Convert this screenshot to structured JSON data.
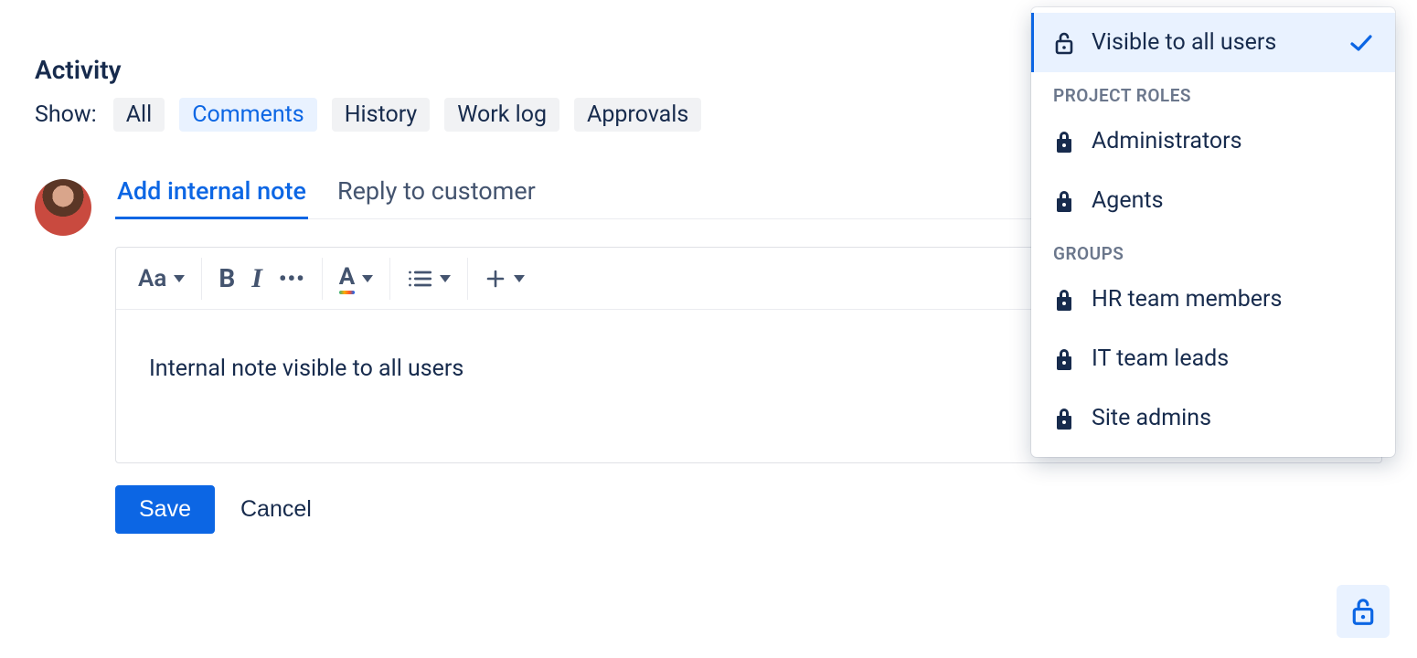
{
  "activity": {
    "heading": "Activity",
    "show_label": "Show:",
    "filters": {
      "all": "All",
      "comments": "Comments",
      "history": "History",
      "work_log": "Work log",
      "approvals": "Approvals"
    }
  },
  "compose": {
    "tabs": {
      "internal": "Add internal note",
      "reply": "Reply to customer"
    },
    "content": "Internal note visible to all users",
    "buttons": {
      "save": "Save",
      "cancel": "Cancel"
    }
  },
  "visibility": {
    "selected": "Visible to all users",
    "section_roles": "PROJECT ROLES",
    "roles": {
      "administrators": "Administrators",
      "agents": "Agents"
    },
    "section_groups": "GROUPS",
    "groups": {
      "hr": "HR team members",
      "it": "IT team leads",
      "site_admins": "Site admins"
    }
  },
  "colors": {
    "accent": "#0C66E4",
    "accent_bg": "#E9F2FF",
    "text": "#172B4D",
    "text_subtle": "#44546F"
  }
}
